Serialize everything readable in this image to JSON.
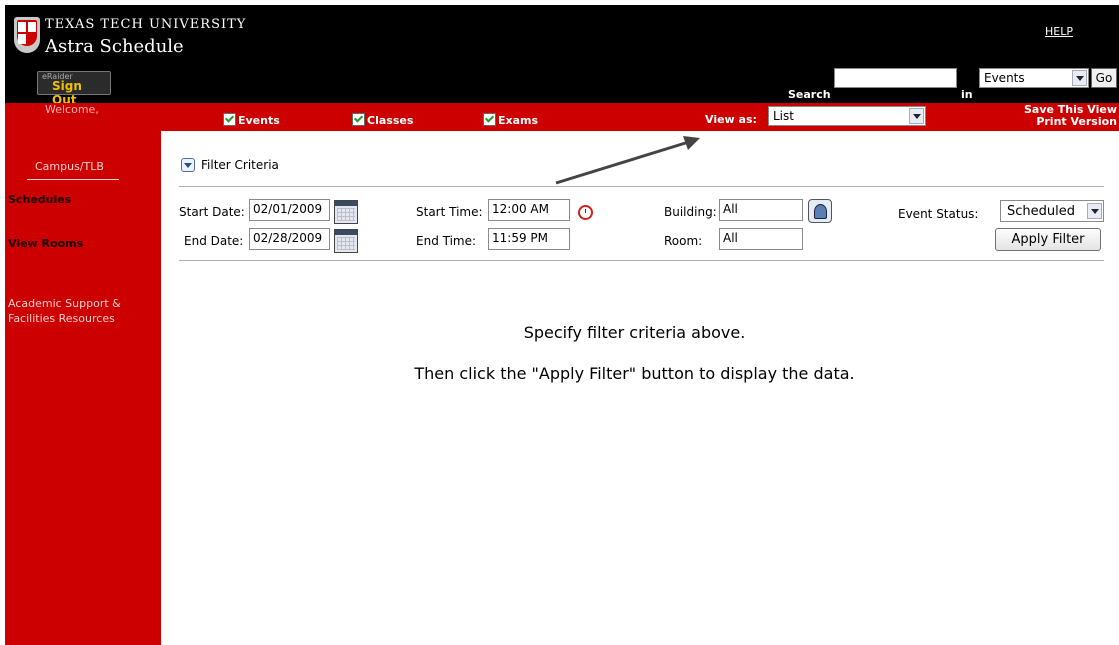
{
  "colors": {
    "brand_red": "#cc0000",
    "header_black": "#000000",
    "signout_accent": "#f0c000"
  },
  "header": {
    "university": "TEXAS TECH UNIVERSITY",
    "app_title": "Astra Schedule",
    "signout_top": "eRaider",
    "signout_label": "Sign Out",
    "help_label": "HELP",
    "search_label": "Search",
    "search_value": "",
    "in_label": "in",
    "scope_value": "Events",
    "go_label": "Go"
  },
  "toolbar": {
    "welcome": "Welcome,",
    "events_label": "Events",
    "classes_label": "Classes",
    "exams_label": "Exams",
    "view_as_label": "View as:",
    "view_as_value": "List",
    "save_view": "Save This View",
    "print_version": "Print Version"
  },
  "sidebar": {
    "campus": "Campus/TLB",
    "schedules": "Schedules",
    "view_rooms": "View Rooms",
    "academic_line1": "Academic Support &",
    "academic_line2": "Facilities Resources"
  },
  "filter": {
    "toggle_label": "Filter Criteria",
    "start_date_label": "Start Date:",
    "start_date_value": "02/01/2009",
    "end_date_label": "End Date:",
    "end_date_value": "02/28/2009",
    "start_time_label": "Start Time:",
    "start_time_value": "12:00 AM",
    "end_time_label": "End Time:",
    "end_time_value": "11:59 PM",
    "building_label": "Building:",
    "building_value": "All",
    "room_label": "Room:",
    "room_value": "All",
    "event_status_label": "Event Status:",
    "event_status_value": "Scheduled",
    "apply_label": "Apply Filter"
  },
  "messages": {
    "line1": "Specify filter criteria above.",
    "line2": "Then click the \"Apply Filter\" button to display the data."
  }
}
